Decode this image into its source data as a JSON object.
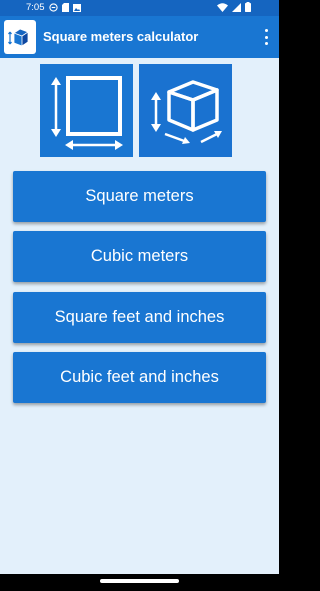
{
  "status_bar": {
    "time": "7:05",
    "icons": [
      "do-not-disturb-icon",
      "sd-card-icon",
      "photo-icon",
      "wifi-icon",
      "signal-icon",
      "battery-icon"
    ]
  },
  "app_bar": {
    "title": "Square meters calculator",
    "logo_icon": "cube-icon",
    "menu_icon": "overflow-menu-icon"
  },
  "tiles": [
    {
      "icon": "square-dimensions-icon"
    },
    {
      "icon": "cube-dimensions-icon"
    }
  ],
  "buttons": [
    {
      "label": "Square meters"
    },
    {
      "label": "Cubic meters"
    },
    {
      "label": "Square feet and inches"
    },
    {
      "label": "Cubic feet and inches"
    }
  ],
  "colors": {
    "primary": "#1976d2",
    "primary_dark": "#1565c0",
    "background": "#e3f0fb",
    "text_on_primary": "#ffffff"
  }
}
